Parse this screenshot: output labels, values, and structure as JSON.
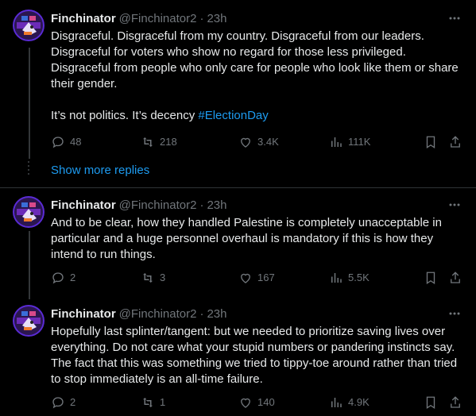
{
  "colors": {
    "background": "#000000",
    "text": "#e7e9ea",
    "muted": "#71767b",
    "accent": "#1d9bf0"
  },
  "tweets": [
    {
      "name": "Finchinator",
      "handle": "@Finchinator2",
      "separator": "·",
      "time": "23h",
      "paragraphs": [
        "Disgraceful. Disgraceful from my country. Disgraceful from our leaders. Disgraceful for voters who show no regard for those less privileged. Disgraceful from people who only care for people who look like them or share their gender."
      ],
      "last_line_text": "It’s not politics. It’s decency ",
      "hashtag": "#ElectionDay",
      "replies": "48",
      "reposts": "218",
      "likes": "3.4K",
      "views": "111K"
    },
    {
      "name": "Finchinator",
      "handle": "@Finchinator2",
      "separator": "·",
      "time": "23h",
      "paragraphs": [
        "And to be clear, how they handled Palestine is completely unacceptable in particular and a huge personnel overhaul is mandatory if this is how they intend to run things."
      ],
      "replies": "2",
      "reposts": "3",
      "likes": "167",
      "views": "5.5K"
    },
    {
      "name": "Finchinator",
      "handle": "@Finchinator2",
      "separator": "·",
      "time": "23h",
      "paragraphs": [
        "Hopefully last splinter/tangent: but we needed to prioritize saving lives over everything. Do not care what your stupid numbers or pandering instincts say. The fact that this was something we tried to tippy-toe around rather than tried to stop immediately is an all-time failure."
      ],
      "replies": "2",
      "reposts": "1",
      "likes": "140",
      "views": "4.9K"
    }
  ],
  "show_more_replies": "Show more replies",
  "icons": {
    "more": "more-horizontal-icon",
    "reply": "reply-icon",
    "repost": "repost-icon",
    "like": "heart-icon",
    "views": "views-chart-icon",
    "bookmark": "bookmark-icon",
    "share": "share-icon"
  }
}
